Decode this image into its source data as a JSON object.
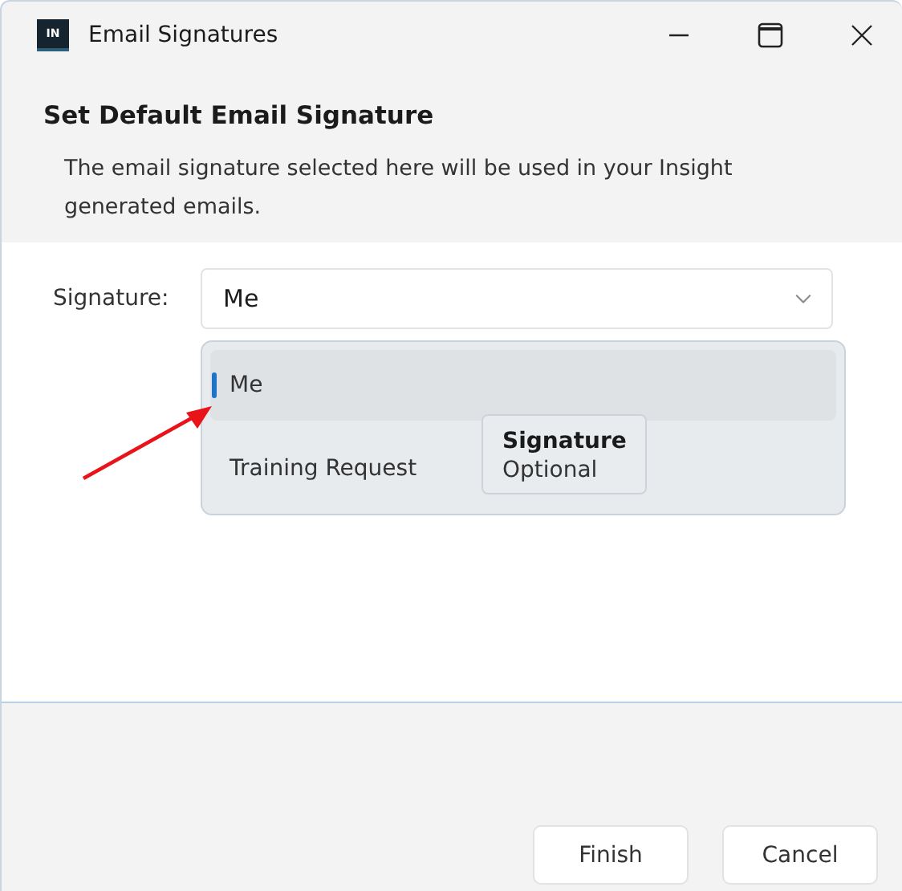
{
  "window": {
    "app_badge": "IN",
    "title": "Email Signatures"
  },
  "header": {
    "title": "Set Default Email Signature",
    "description": "The email signature selected here will be used in your Insight generated emails."
  },
  "signature_field": {
    "label": "Signature:",
    "value": "Me",
    "expanded": true,
    "options": [
      {
        "label": "Me",
        "selected": true
      },
      {
        "label": "Training Request",
        "selected": false
      }
    ]
  },
  "tooltip": {
    "title": "Signature",
    "subtitle": "Optional"
  },
  "buttons": [
    "Finish",
    "Cancel"
  ]
}
